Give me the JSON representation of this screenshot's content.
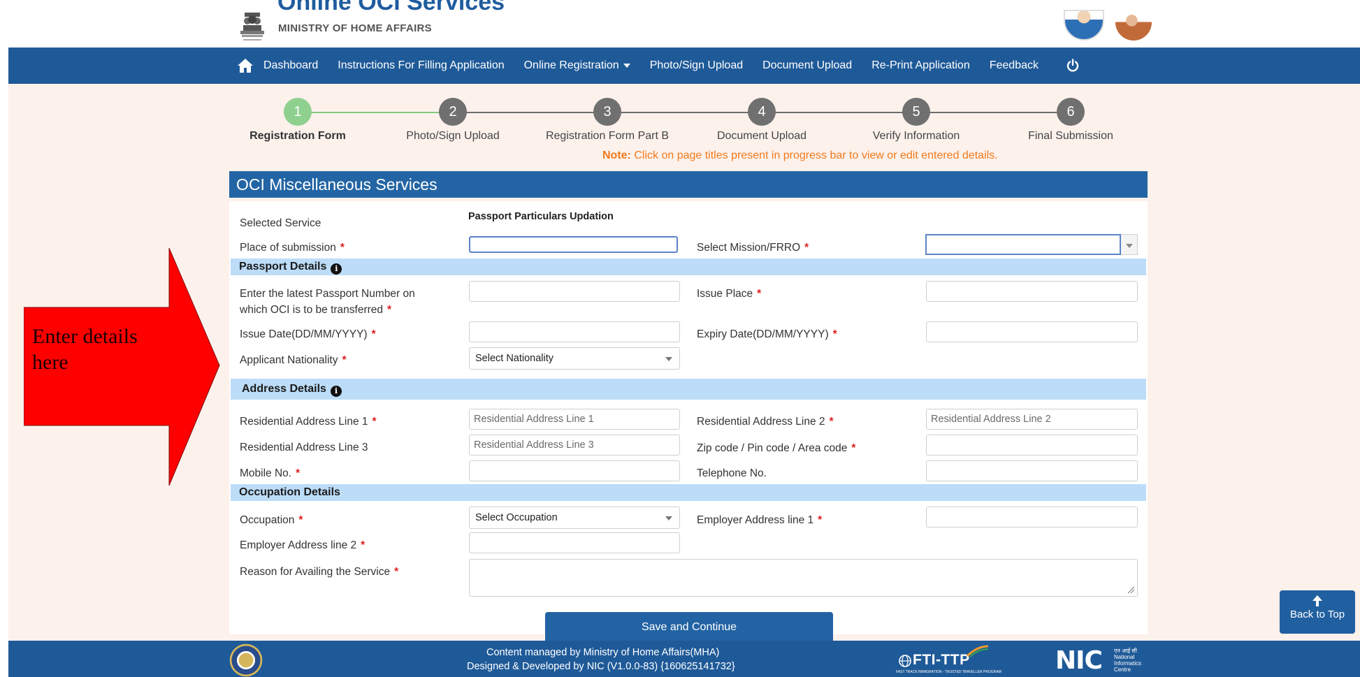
{
  "header": {
    "site_title": "Online OCI Services",
    "ministry": "MINISTRY OF HOME AFFAIRS"
  },
  "nav": {
    "items": [
      {
        "label": "Dashboard"
      },
      {
        "label": "Instructions For Filling Application"
      },
      {
        "label": "Online Registration"
      },
      {
        "label": "Photo/Sign Upload"
      },
      {
        "label": "Document Upload"
      },
      {
        "label": "Re-Print Application"
      },
      {
        "label": "Feedback"
      }
    ]
  },
  "stepper": {
    "steps": [
      {
        "number": "1",
        "label": "Registration Form"
      },
      {
        "number": "2",
        "label": "Photo/Sign Upload"
      },
      {
        "number": "3",
        "label": "Registration Form Part B"
      },
      {
        "number": "4",
        "label": "Document Upload"
      },
      {
        "number": "5",
        "label": "Verify Information"
      },
      {
        "number": "6",
        "label": "Final Submission"
      }
    ],
    "note_prefix": "Note:",
    "note_text": " Click on page titles present in progress bar to view or edit entered details."
  },
  "panel": {
    "title": "OCI Miscellaneous Services",
    "selected_service_label": "Selected Service",
    "selected_service_value": "Passport Particulars Updation",
    "place_of_submission_label": "Place of submission",
    "mission_label": "Select Mission/FRRO"
  },
  "passport": {
    "section_title": "Passport Details",
    "passport_number_label_1": "Enter the latest Passport Number on",
    "passport_number_label_2": "which OCI is to be transferred",
    "issue_place_label": "Issue Place",
    "issue_date_label": "Issue Date(DD/MM/YYYY)",
    "expiry_date_label": "Expiry Date(DD/MM/YYYY)",
    "nationality_label": "Applicant Nationality",
    "nationality_value": "Select Nationality"
  },
  "address": {
    "section_title": "Address Details",
    "line1_label": "Residential Address Line 1",
    "line1_placeholder": "Residential Address Line 1",
    "line2_label": "Residential Address Line 2",
    "line2_placeholder": "Residential Address Line 2",
    "line3_label": "Residential Address Line 3",
    "line3_placeholder": "Residential Address Line 3",
    "zip_label": "Zip code / Pin code / Area code",
    "mobile_label": "Mobile No.",
    "telephone_label": "Telephone No."
  },
  "occupation": {
    "section_title": "Occupation Details",
    "occupation_label": "Occupation",
    "occupation_value": "Select Occupation",
    "employer_line1_label": "Employer Address line 1",
    "employer_line2_label": "Employer Address line 2",
    "reason_label": "Reason for Availing the Service"
  },
  "actions": {
    "save_label": "Save and Continue",
    "back_to_top_label": "Back to Top"
  },
  "annotation": {
    "text": "Enter details here"
  },
  "footer": {
    "line1": "Content managed by Ministry of Home Affairs(MHA)",
    "line2": "Designed & Developed by NIC (V1.0.0-83) {160625141732}",
    "fti_name": "FTI-TTP",
    "fti_tagline": "FAST TRACK IMMIGRATION - TRUSTED TRAVELLER PROGRAM",
    "nic_short": "NIC",
    "nic_hindi": "एन आई सी",
    "nic_full_1": "National",
    "nic_full_2": "Informatics",
    "nic_full_3": "Centre"
  },
  "colors": {
    "nav_blue": "#1f5a98",
    "required_red": "#e02020",
    "section_blue": "#bcdcf8",
    "note_orange": "#f07a1c",
    "step_done_green": "#8fd08f"
  }
}
